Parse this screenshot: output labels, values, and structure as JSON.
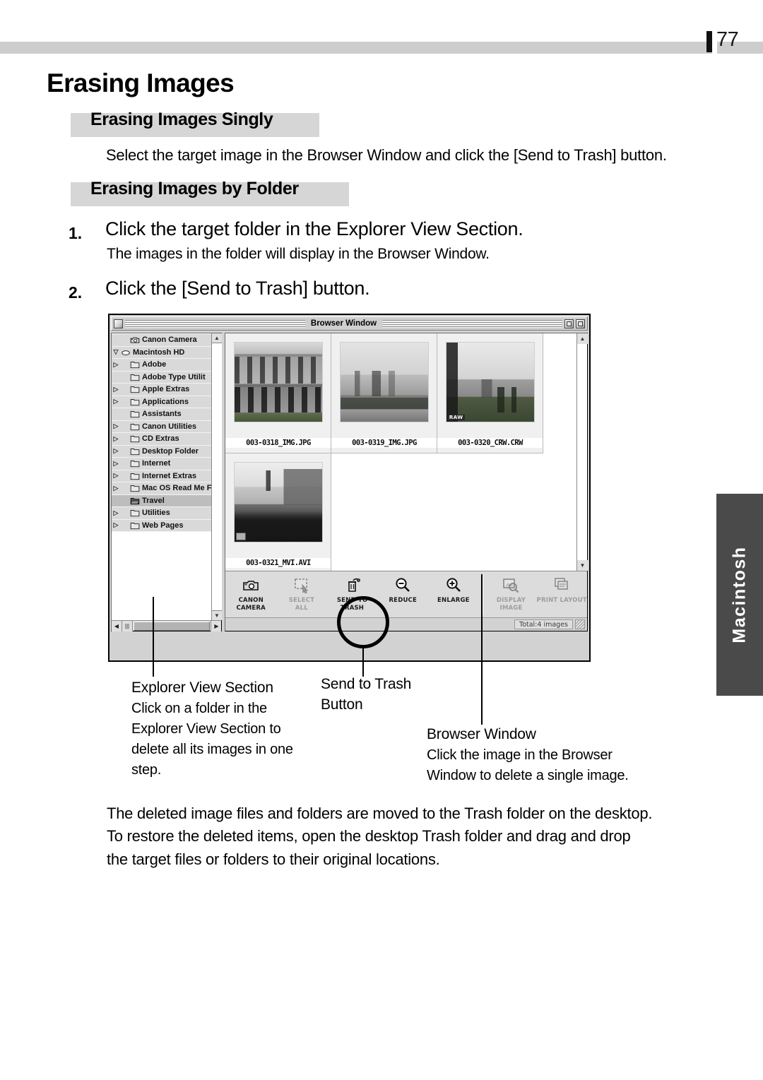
{
  "page": {
    "number": "77",
    "side_tab": "Macintosh"
  },
  "headings": {
    "h1": "Erasing Images",
    "section_singly": "Erasing Images Singly",
    "section_by_folder": "Erasing Images by Folder"
  },
  "singly": {
    "body": "Select the target image in the Browser Window and click the [Send to Trash] button."
  },
  "steps": [
    {
      "num": "1.",
      "main": "Click the target folder in the Explorer View Section.",
      "sub": "The images in the folder will display in the Browser Window."
    },
    {
      "num": "2.",
      "main": "Click the [Send to Trash] button.",
      "sub": ""
    }
  ],
  "screenshot": {
    "window_title": "Browser Window",
    "tree": {
      "items": [
        {
          "label": "Canon Camera",
          "indent": 1,
          "twisty": "",
          "icon": "camera-icon",
          "selected": false
        },
        {
          "label": "Macintosh HD",
          "indent": 0,
          "twisty": "▽",
          "icon": "drive-icon",
          "selected": false
        },
        {
          "label": "Adobe",
          "indent": 1,
          "twisty": "▷",
          "icon": "folder-icon",
          "selected": false
        },
        {
          "label": "Adobe Type Utilit",
          "indent": 1,
          "twisty": "",
          "icon": "folder-icon",
          "selected": false
        },
        {
          "label": "Apple Extras",
          "indent": 1,
          "twisty": "▷",
          "icon": "folder-icon",
          "selected": false
        },
        {
          "label": "Applications",
          "indent": 1,
          "twisty": "▷",
          "icon": "folder-icon",
          "selected": false
        },
        {
          "label": "Assistants",
          "indent": 1,
          "twisty": "",
          "icon": "folder-icon",
          "selected": false
        },
        {
          "label": "Canon Utilities",
          "indent": 1,
          "twisty": "▷",
          "icon": "folder-icon",
          "selected": false
        },
        {
          "label": "CD Extras",
          "indent": 1,
          "twisty": "▷",
          "icon": "folder-icon",
          "selected": false
        },
        {
          "label": "Desktop Folder",
          "indent": 1,
          "twisty": "▷",
          "icon": "folder-icon",
          "selected": false
        },
        {
          "label": "Internet",
          "indent": 1,
          "twisty": "▷",
          "icon": "folder-icon",
          "selected": false
        },
        {
          "label": "Internet Extras",
          "indent": 1,
          "twisty": "▷",
          "icon": "folder-icon",
          "selected": false
        },
        {
          "label": "Mac OS Read Me F",
          "indent": 1,
          "twisty": "▷",
          "icon": "folder-icon",
          "selected": false
        },
        {
          "label": "Travel",
          "indent": 1,
          "twisty": "",
          "icon": "folder-open-icon",
          "selected": true
        },
        {
          "label": "Utilities",
          "indent": 1,
          "twisty": "▷",
          "icon": "folder-icon",
          "selected": false
        },
        {
          "label": "Web Pages",
          "indent": 1,
          "twisty": "▷",
          "icon": "folder-icon",
          "selected": false
        }
      ]
    },
    "thumbnails": [
      {
        "name": "003-0318_IMG.JPG",
        "badge": ""
      },
      {
        "name": "003-0319_IMG.JPG",
        "badge": ""
      },
      {
        "name": "003-0320_CRW.CRW",
        "badge": "RAW"
      },
      {
        "name": "003-0321_MVI.AVI",
        "badge": "MOVIE"
      }
    ],
    "toolbar": [
      {
        "label": "CANON CAMERA",
        "icon": "camera-icon",
        "enabled": true
      },
      {
        "label": "SELECT\nALL",
        "icon": "select-all-icon",
        "enabled": false
      },
      {
        "label": "SEND TO\nTRASH",
        "icon": "trash-icon",
        "enabled": true
      },
      {
        "label": "REDUCE",
        "icon": "zoom-out-icon",
        "enabled": true
      },
      {
        "label": "ENLARGE",
        "icon": "zoom-in-icon",
        "enabled": true
      },
      {
        "label": "DISPLAY IMAGE",
        "icon": "display-image-icon",
        "enabled": false
      },
      {
        "label": "PRINT LAYOUT",
        "icon": "print-layout-icon",
        "enabled": false
      }
    ],
    "status": "Total:4 images"
  },
  "callouts": {
    "explorer": {
      "title": "Explorer View Section",
      "body": "Click on a folder in the Explorer View Section to delete all its images in one step."
    },
    "trash": {
      "title_line1": "Send to Trash",
      "title_line2": "Button"
    },
    "browser": {
      "title": "Browser Window",
      "body_line1": "Click the image in the Browser",
      "body_line2": "Window to delete a single image."
    }
  },
  "bottom_paragraph": {
    "line1": "The deleted image files and folders are moved to the Trash folder on the desktop.",
    "line2": "To restore the deleted items, open the desktop Trash folder and drag and drop",
    "line3": "the target files or folders to their original locations."
  },
  "colors": {
    "heading_band": "#d6d6d6",
    "header_rule": "#cdcdcd",
    "side_tab": "#4a4a4a",
    "window_chrome": "#d2d2d2"
  }
}
